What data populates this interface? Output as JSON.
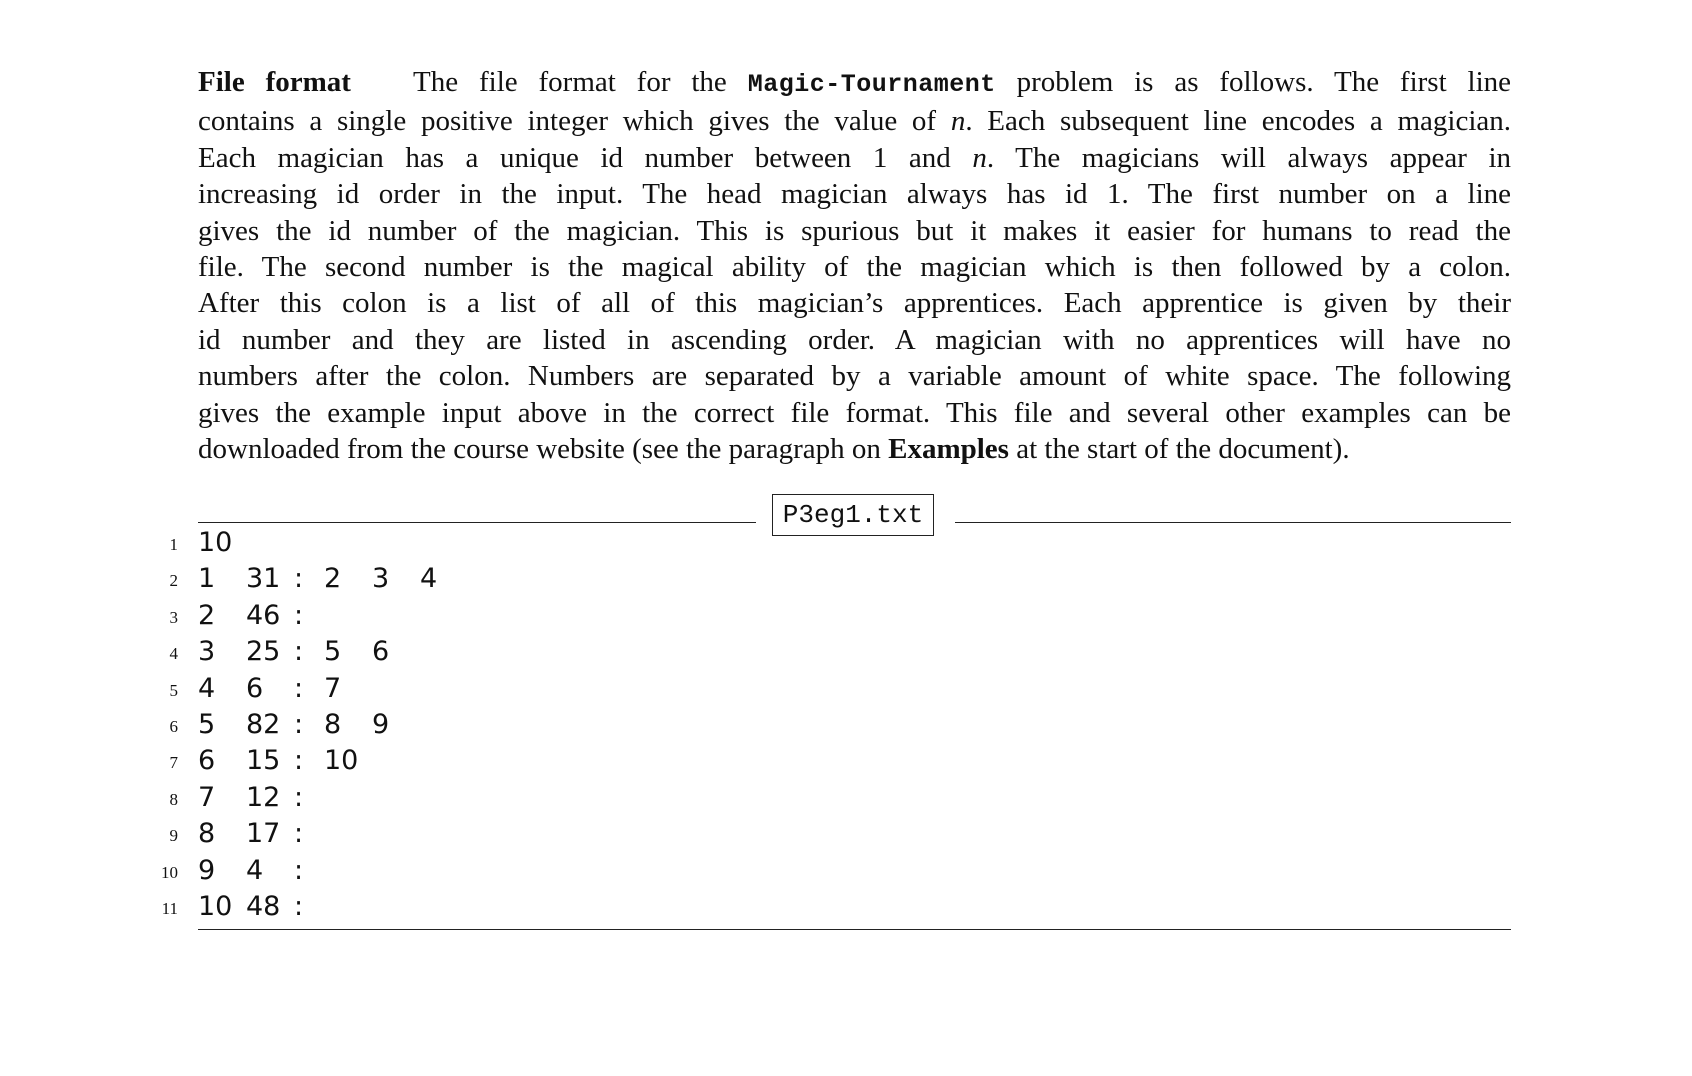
{
  "paragraph": {
    "heading": "File format",
    "lines": [
      {
        "pre": "The file format for the ",
        "problem": "Magic-Tournament",
        "post": " problem is as follows. The first line"
      },
      {
        "pre": "contains a single positive integer which gives the value of ",
        "var": "n",
        "post": ". Each subsequent line encodes a magician."
      },
      {
        "pre": "Each magician has a unique id number between 1 and ",
        "var": "n",
        "post": ". The magicians will always appear in"
      },
      {
        "text": "increasing id order in the input. The head magician always has id 1. The first number on a line"
      },
      {
        "text": "gives the id number of the magician. This is spurious but it makes it easier for humans to read the"
      },
      {
        "text": "file. The second number is the magical ability of the magician which is then followed by a colon."
      },
      {
        "text": "After this colon is a list of all of this magician’s apprentices. Each apprentice is given by their"
      },
      {
        "text": "id number and they are listed in ascending order. A magician with no apprentices will have no"
      },
      {
        "text": "numbers after the colon. Numbers are separated by a variable amount of white space. The following"
      },
      {
        "text": "gives the example input above in the correct file format. This file and several other examples can be"
      },
      {
        "pre": "downloaded from the course website (see the paragraph on ",
        "strong": "Examples",
        "post": " at the start of the document)."
      }
    ]
  },
  "file": {
    "name": "P3eg1.txt",
    "lines": [
      {
        "num": "1",
        "cols": [
          "10"
        ]
      },
      {
        "num": "2",
        "cols": [
          "1",
          "31",
          ":",
          "2",
          "3",
          "4"
        ]
      },
      {
        "num": "3",
        "cols": [
          "2",
          "46",
          ":"
        ]
      },
      {
        "num": "4",
        "cols": [
          "3",
          "25",
          ":",
          "5",
          "6"
        ]
      },
      {
        "num": "5",
        "cols": [
          "4",
          "6",
          ":",
          "7"
        ]
      },
      {
        "num": "6",
        "cols": [
          "5",
          "82",
          ":",
          "8",
          "9"
        ]
      },
      {
        "num": "7",
        "cols": [
          "6",
          "15",
          ":",
          "10"
        ]
      },
      {
        "num": "8",
        "cols": [
          "7",
          "12",
          ":"
        ]
      },
      {
        "num": "9",
        "cols": [
          "8",
          "17",
          ":"
        ]
      },
      {
        "num": "10",
        "cols": [
          "9",
          "4",
          ":"
        ]
      },
      {
        "num": "11",
        "cols": [
          "10",
          "48",
          ":"
        ]
      }
    ]
  }
}
